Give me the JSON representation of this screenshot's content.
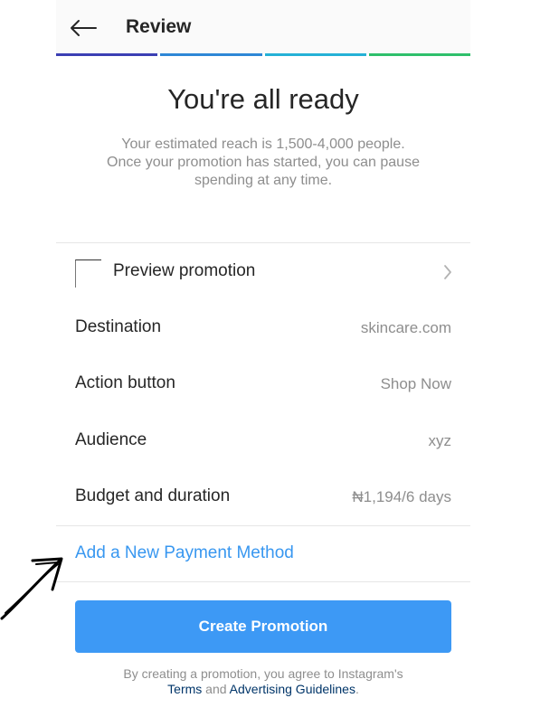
{
  "header": {
    "title": "Review",
    "progress_colors": [
      "#3b3fb4",
      "#2e87d6",
      "#25b1d6",
      "#2fbf6b"
    ]
  },
  "hero": {
    "title": "You're all ready",
    "subtitle_lines": [
      "Your estimated reach is 1,500-4,000 people.",
      "Once your promotion has started, you can pause",
      "spending at any time."
    ]
  },
  "preview": {
    "label": "Preview promotion"
  },
  "details": [
    {
      "label": "Destination",
      "value": "skincare.com"
    },
    {
      "label": "Action button",
      "value": "Shop Now"
    },
    {
      "label": "Audience",
      "value": "xyz"
    },
    {
      "label": "Budget and duration",
      "value": "₦1,194/6 days"
    }
  ],
  "payment": {
    "link_label": "Add a New Payment Method"
  },
  "cta": {
    "label": "Create Promotion"
  },
  "legal": {
    "line1": "By creating a promotion, you agree to Instagram's",
    "terms": "Terms",
    "and": "and",
    "guidelines": "Advertising Guidelines",
    "period": "."
  },
  "colors": {
    "link": "#3897f0",
    "button": "#3d99f5",
    "muted": "#8e8e8e"
  }
}
